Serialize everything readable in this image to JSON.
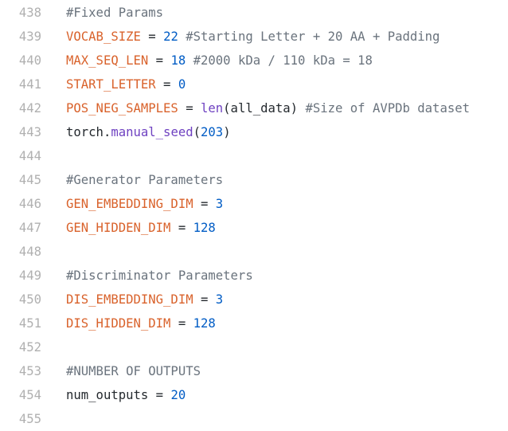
{
  "colors": {
    "variable": "#d9622b",
    "number": "#005cc5",
    "function": "#6f42c1",
    "comment": "#6a737d",
    "text": "#24292e",
    "line_number": "#b0b0b0"
  },
  "lines": [
    {
      "n": "438",
      "tokens": [
        {
          "t": "com",
          "v": "#Fixed Params"
        }
      ]
    },
    {
      "n": "439",
      "tokens": [
        {
          "t": "var",
          "v": "VOCAB_SIZE"
        },
        {
          "t": "op",
          "v": " = "
        },
        {
          "t": "num",
          "v": "22"
        },
        {
          "t": "com",
          "v": " #Starting Letter + 20 AA + Padding"
        }
      ]
    },
    {
      "n": "440",
      "tokens": [
        {
          "t": "var",
          "v": "MAX_SEQ_LEN"
        },
        {
          "t": "op",
          "v": " = "
        },
        {
          "t": "num",
          "v": "18"
        },
        {
          "t": "com",
          "v": " #2000 kDa / 110 kDa = 18"
        }
      ]
    },
    {
      "n": "441",
      "tokens": [
        {
          "t": "var",
          "v": "START_LETTER"
        },
        {
          "t": "op",
          "v": " = "
        },
        {
          "t": "num",
          "v": "0"
        }
      ]
    },
    {
      "n": "442",
      "tokens": [
        {
          "t": "var",
          "v": "POS_NEG_SAMPLES"
        },
        {
          "t": "op",
          "v": " = "
        },
        {
          "t": "fn",
          "v": "len"
        },
        {
          "t": "txt",
          "v": "(all_data)"
        },
        {
          "t": "com",
          "v": " #Size of AVPDb dataset"
        }
      ]
    },
    {
      "n": "443",
      "tokens": [
        {
          "t": "txt",
          "v": "torch."
        },
        {
          "t": "fn",
          "v": "manual_seed"
        },
        {
          "t": "txt",
          "v": "("
        },
        {
          "t": "num",
          "v": "203"
        },
        {
          "t": "txt",
          "v": ")"
        }
      ]
    },
    {
      "n": "444",
      "tokens": []
    },
    {
      "n": "445",
      "tokens": [
        {
          "t": "com",
          "v": "#Generator Parameters"
        }
      ]
    },
    {
      "n": "446",
      "tokens": [
        {
          "t": "var",
          "v": "GEN_EMBEDDING_DIM"
        },
        {
          "t": "op",
          "v": " = "
        },
        {
          "t": "num",
          "v": "3"
        }
      ]
    },
    {
      "n": "447",
      "tokens": [
        {
          "t": "var",
          "v": "GEN_HIDDEN_DIM"
        },
        {
          "t": "op",
          "v": " = "
        },
        {
          "t": "num",
          "v": "128"
        }
      ]
    },
    {
      "n": "448",
      "tokens": []
    },
    {
      "n": "449",
      "tokens": [
        {
          "t": "com",
          "v": "#Discriminator Parameters"
        }
      ]
    },
    {
      "n": "450",
      "tokens": [
        {
          "t": "var",
          "v": "DIS_EMBEDDING_DIM"
        },
        {
          "t": "op",
          "v": " = "
        },
        {
          "t": "num",
          "v": "3"
        }
      ]
    },
    {
      "n": "451",
      "tokens": [
        {
          "t": "var",
          "v": "DIS_HIDDEN_DIM"
        },
        {
          "t": "op",
          "v": " = "
        },
        {
          "t": "num",
          "v": "128"
        }
      ]
    },
    {
      "n": "452",
      "tokens": []
    },
    {
      "n": "453",
      "tokens": [
        {
          "t": "com",
          "v": "#NUMBER OF OUTPUTS"
        }
      ]
    },
    {
      "n": "454",
      "tokens": [
        {
          "t": "txt",
          "v": "num_outputs"
        },
        {
          "t": "op",
          "v": " = "
        },
        {
          "t": "num",
          "v": "20"
        }
      ]
    },
    {
      "n": "455",
      "tokens": []
    }
  ]
}
